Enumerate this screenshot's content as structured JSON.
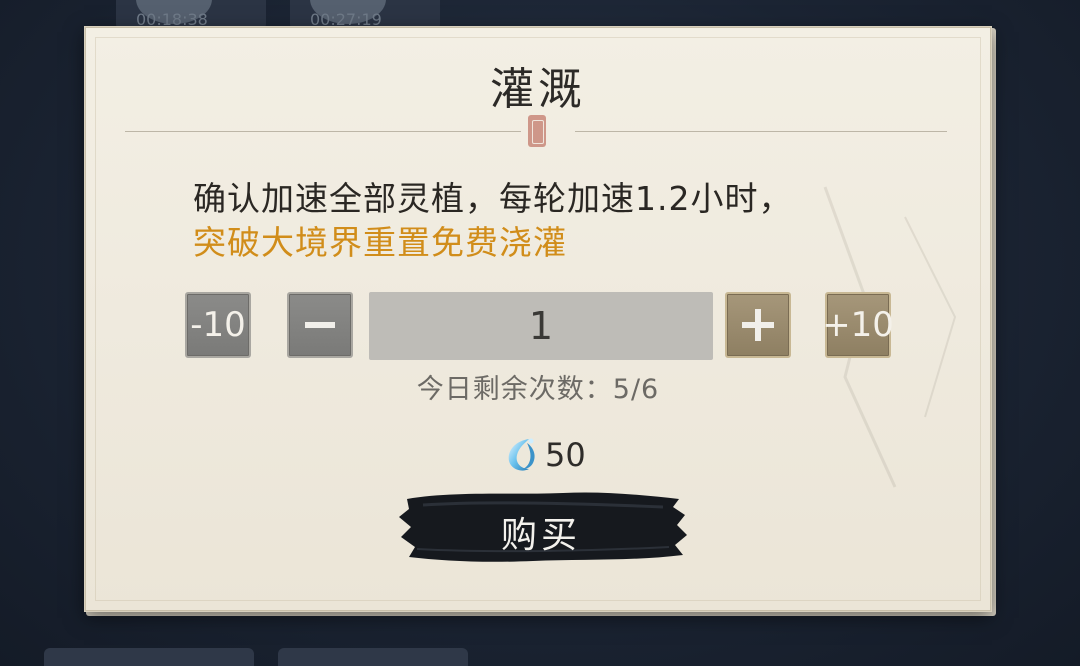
{
  "background": {
    "tiles": [
      {
        "time": "00:18:38"
      },
      {
        "time": "00:27:19"
      }
    ]
  },
  "dialog": {
    "title": "灌溉",
    "description_line1": "确认加速全部灵植，每轮加速1.2小时，",
    "description_line2": "突破大境界重置免费浇灌",
    "highlight_color": "#d18d1a",
    "quantity": {
      "minus10_label": "-10",
      "plus10_label": "+10",
      "value": "1"
    },
    "remaining_text": "今日剩余次数：5/6",
    "cost": {
      "icon": "water-drop-icon",
      "value": "50"
    },
    "buy_label": "购买"
  }
}
